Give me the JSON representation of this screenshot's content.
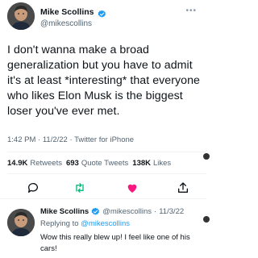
{
  "tweet": {
    "author_name": "Mike Scollins",
    "author_handle": "@mikescollins",
    "text": "I don't wanna make a broad generalization but you have to admit it's at least *interesting* that everyone who likes Elon Musk is the biggest loser you've ever met.",
    "time": "1:42 PM",
    "date": "11/2/22",
    "source": "Twitter for iPhone",
    "meta_separator": "·",
    "retweets_count": "14.9K",
    "retweets_label": "Retweets",
    "quotes_count": "693",
    "quotes_label": "Quote Tweets",
    "likes_count": "138K",
    "likes_label": "Likes"
  },
  "reply": {
    "author_name": "Mike Scollins",
    "author_handle": "@mikescollins",
    "separator": "·",
    "date": "11/3/22",
    "replying_prefix": "Replying to",
    "replying_to": "@mikescollins",
    "text": "Wow this really blew up! I feel like one of his cars!"
  },
  "icons": {
    "verified": "verified-badge-icon",
    "more": "more-dots-icon",
    "reply": "comment-icon",
    "retweet": "retweet-icon",
    "like": "heart-icon",
    "share": "share-icon"
  },
  "colors": {
    "verified_blue": "#1d9bf0",
    "retweet_green": "#00ba7c",
    "like_red": "#f91880",
    "secondary_text": "#536471",
    "link_blue": "#1d9bf0"
  }
}
